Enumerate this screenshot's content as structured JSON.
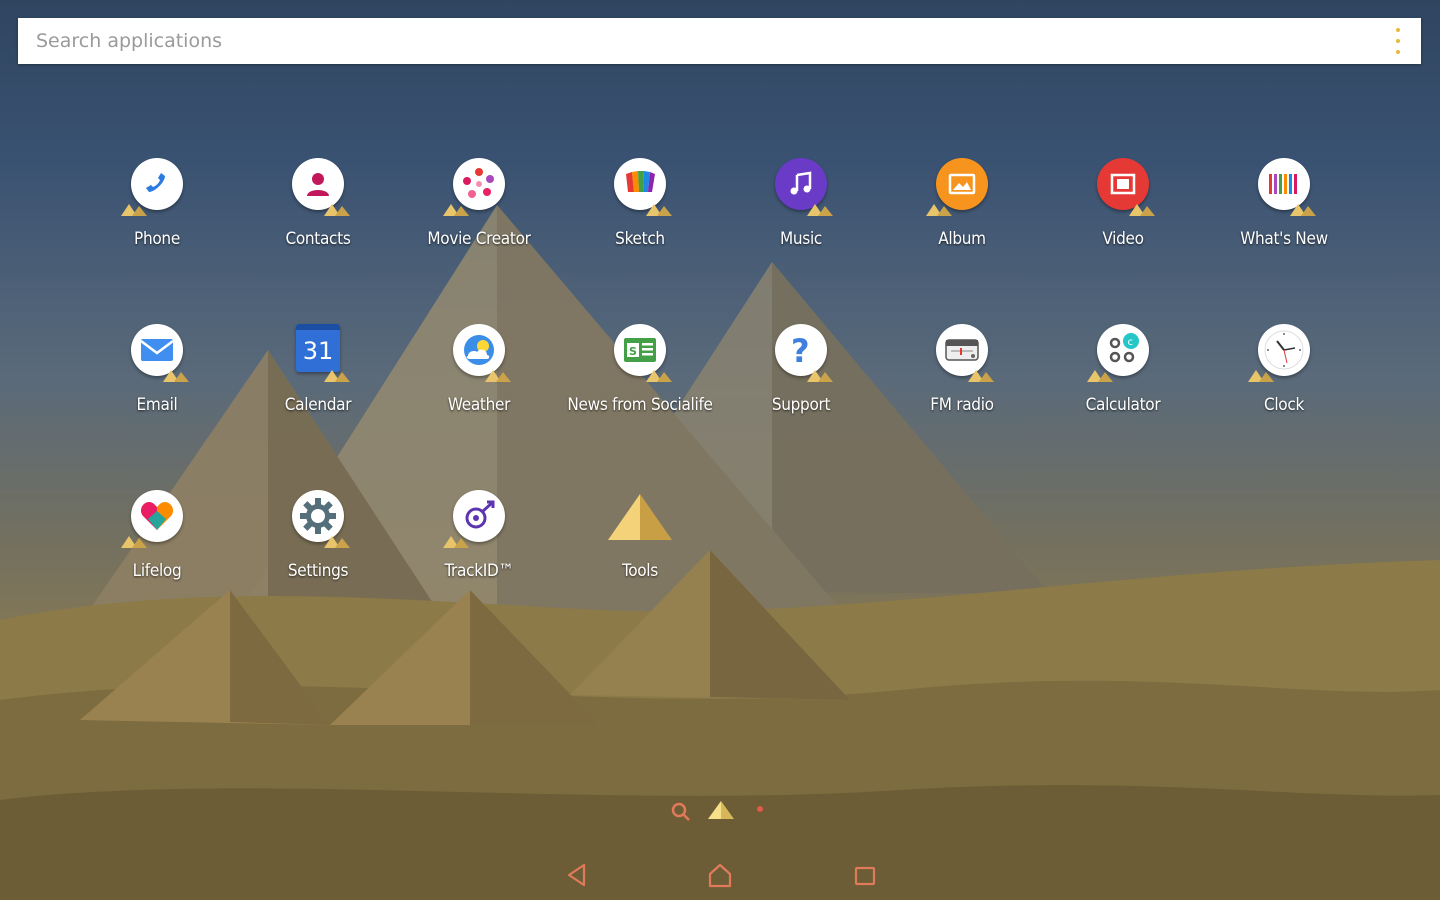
{
  "search": {
    "placeholder": "Search applications",
    "value": ""
  },
  "apps": [
    {
      "label": "Phone",
      "icon": "phone-icon"
    },
    {
      "label": "Contacts",
      "icon": "contacts-icon"
    },
    {
      "label": "Movie Creator",
      "icon": "movie-creator-icon"
    },
    {
      "label": "Sketch",
      "icon": "sketch-icon"
    },
    {
      "label": "Music",
      "icon": "music-icon"
    },
    {
      "label": "Album",
      "icon": "album-icon"
    },
    {
      "label": "Video",
      "icon": "video-icon"
    },
    {
      "label": "What's New",
      "icon": "whats-new-icon"
    },
    {
      "label": "Email",
      "icon": "email-icon"
    },
    {
      "label": "Calendar",
      "icon": "calendar-icon",
      "icon_text": "31"
    },
    {
      "label": "Weather",
      "icon": "weather-icon"
    },
    {
      "label": "News from Socialife",
      "icon": "socialife-icon"
    },
    {
      "label": "Support",
      "icon": "support-icon"
    },
    {
      "label": "FM radio",
      "icon": "fm-radio-icon"
    },
    {
      "label": "Calculator",
      "icon": "calculator-icon"
    },
    {
      "label": "Clock",
      "icon": "clock-icon"
    },
    {
      "label": "Lifelog",
      "icon": "lifelog-icon"
    },
    {
      "label": "Settings",
      "icon": "settings-icon"
    },
    {
      "label": "TrackID™",
      "icon": "trackid-icon"
    },
    {
      "label": "Tools",
      "icon": "tools-folder-icon"
    }
  ],
  "colors": {
    "accent": "#e8b93a",
    "nav_accent": "#e07b5a",
    "sky_top": "#2f4560",
    "sand": "#8a7a52"
  }
}
